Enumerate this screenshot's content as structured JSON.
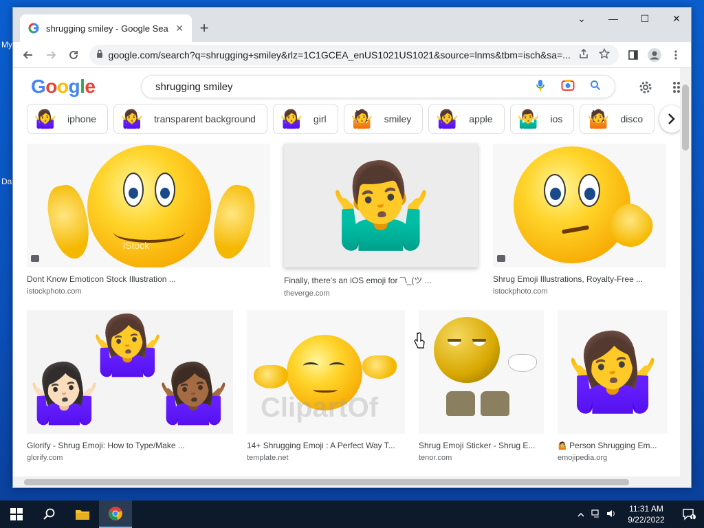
{
  "desktop": {
    "labels": [
      "My",
      "Da"
    ]
  },
  "browser": {
    "tab_title": "shrugging smiley - Google Search",
    "tab_close": "✕",
    "new_tab": "+",
    "url": "google.com/search?q=shrugging+smiley&rlz=1C1GCEA_enUS1021US1021&source=lnms&tbm=isch&sa=...",
    "window_controls": {
      "tabsearch": "⌄",
      "minimize": "—",
      "maximize": "☐",
      "close": "✕"
    }
  },
  "google": {
    "logo": "Google",
    "query": "shrugging smiley"
  },
  "chips": [
    {
      "label": "iphone",
      "thumb": "🤷‍♀️"
    },
    {
      "label": "transparent background",
      "thumb": "🤷‍♀️"
    },
    {
      "label": "girl",
      "thumb": "🤷‍♀️"
    },
    {
      "label": "smiley",
      "thumb": "🤷"
    },
    {
      "label": "apple",
      "thumb": "🤷‍♀️"
    },
    {
      "label": "ios",
      "thumb": "🤷‍♂️"
    },
    {
      "label": "disco",
      "thumb": "🤷"
    }
  ],
  "results": [
    {
      "title": "Dont Know Emoticon Stock Illustration ...",
      "source": "istockphoto.com"
    },
    {
      "title": "Finally, there's an iOS emoji for ¯\\_(ツ ...",
      "source": "theverge.com"
    },
    {
      "title": "Shrug Emoji Illustrations, Royalty-Free ...",
      "source": "istockphoto.com"
    },
    {
      "title": "Glorify - Shrug Emoji: How to Type/Make ...",
      "source": "glorify.com"
    },
    {
      "title": "14+ Shrugging Emoji : A Perfect Way T...",
      "source": "template.net"
    },
    {
      "title": "Shrug Emoji Sticker - Shrug E...",
      "source": "tenor.com"
    },
    {
      "title": "Person Shrugging Em...",
      "source": "emojipedia.org"
    }
  ],
  "watermarks": {
    "clipart": "ClipartOf",
    "istock": "iStock"
  },
  "taskbar": {
    "time": "11:31 AM",
    "date": "9/22/2022",
    "notifications": "1"
  }
}
